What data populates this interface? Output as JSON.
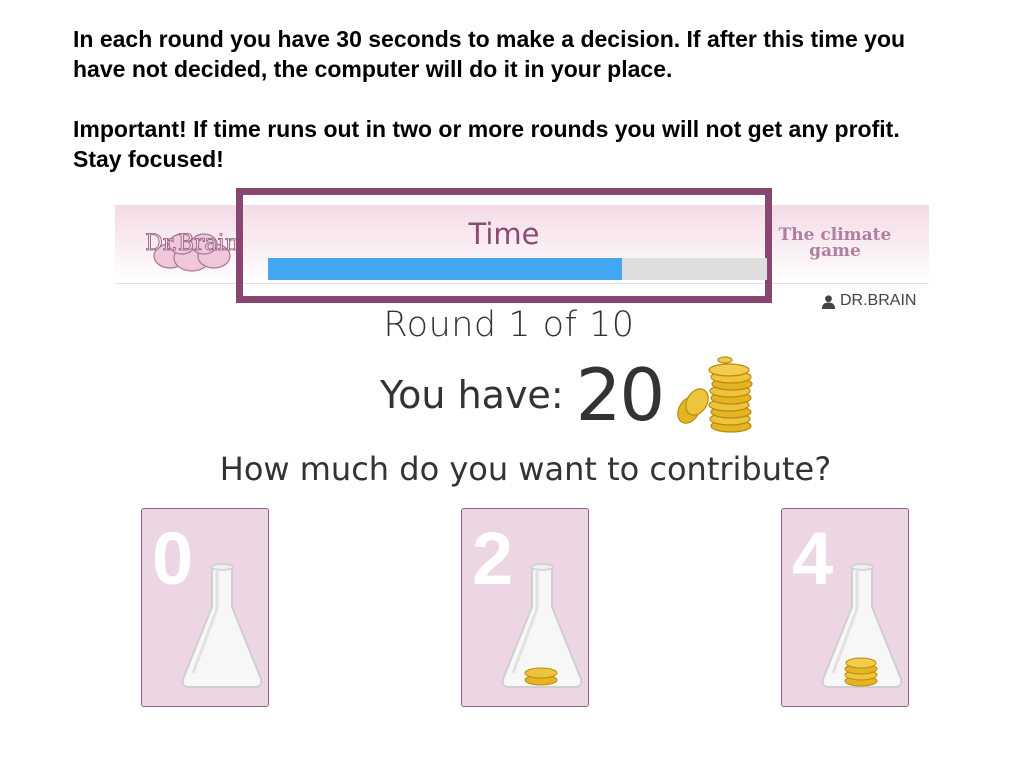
{
  "instructions": {
    "line1": "In each round you have 30 seconds to make a decision. If after this time you have not decided, the computer will do it in your place.",
    "line2": "Important! If time runs out in two or more rounds you will not get any profit. Stay focused!"
  },
  "header": {
    "logo_text": "Dr.Brain",
    "game_title_line1": "The climate",
    "game_title_line2": "game",
    "user": "DR.BRAIN"
  },
  "timer": {
    "label": "Time",
    "progress_fraction": 0.71
  },
  "round": {
    "text": "Round 1 of 10"
  },
  "balance": {
    "label": "You have:",
    "value": "20"
  },
  "question": "How much do you want to contribute?",
  "options": [
    {
      "label": "0",
      "coins": 0
    },
    {
      "label": "2",
      "coins": 2
    },
    {
      "label": "4",
      "coins": 4
    }
  ],
  "colors": {
    "accent": "#8a4673",
    "progress": "#42a7f0",
    "card_bg": "#ecd6e3",
    "coin": "#e4b422"
  }
}
